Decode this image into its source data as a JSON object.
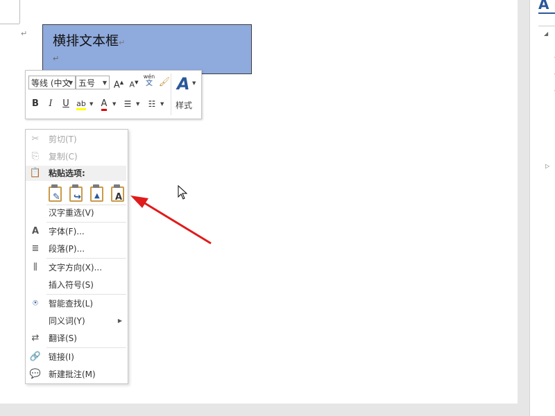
{
  "document": {
    "textbox_text": "横排文本框",
    "paragraph_mark": "↵"
  },
  "mini_toolbar": {
    "font_name": "等线 (中文",
    "font_size": "五号",
    "grow_font": "A",
    "shrink_font": "A",
    "phonetic_top": "wén",
    "phonetic_bottom": "文",
    "bold": "B",
    "italic": "I",
    "underline": "U",
    "highlight": "ab",
    "font_color": "A",
    "styles_label": "样式",
    "font_color_hex": "#e00000",
    "highlight_hex": "#ffff00"
  },
  "context_menu": {
    "cut": "剪切(T)",
    "copy": "复制(C)",
    "paste_header": "粘贴选项:",
    "reconvert": "汉字重选(V)",
    "font": "字体(F)...",
    "paragraph": "段落(P)...",
    "text_direction": "文字方向(X)...",
    "insert_symbol": "插入符号(S)",
    "smart_lookup": "智能查找(L)",
    "synonyms": "同义词(Y)",
    "translate": "翻译(S)",
    "link": "链接(I)",
    "new_comment": "新建批注(M)"
  },
  "right_panel": {
    "header_letter": "A"
  },
  "colors": {
    "textbox_fill": "#8faadc",
    "arrow": "#e01b1b",
    "accent": "#2b579a"
  }
}
